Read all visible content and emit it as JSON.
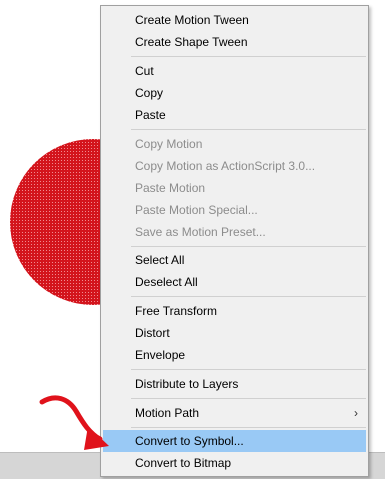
{
  "colors": {
    "circle_fill": "#d3141c",
    "arrow": "#e0121b",
    "menu_bg": "#f0f0f0",
    "highlight": "#99c9f5",
    "disabled_text": "#8c8c8c"
  },
  "menu": {
    "items": [
      {
        "label": "Create Motion Tween"
      },
      {
        "label": "Create Shape Tween"
      },
      {
        "label": "Cut"
      },
      {
        "label": "Copy"
      },
      {
        "label": "Paste"
      },
      {
        "label": "Copy Motion"
      },
      {
        "label": "Copy Motion as ActionScript 3.0..."
      },
      {
        "label": "Paste Motion"
      },
      {
        "label": "Paste Motion Special..."
      },
      {
        "label": "Save as Motion Preset..."
      },
      {
        "label": "Select All"
      },
      {
        "label": "Deselect All"
      },
      {
        "label": "Free Transform"
      },
      {
        "label": "Distort"
      },
      {
        "label": "Envelope"
      },
      {
        "label": "Distribute to Layers"
      },
      {
        "label": "Motion Path",
        "submenu_icon": "chevron-right-icon",
        "arrow": "›"
      },
      {
        "label": "Convert to Symbol..."
      },
      {
        "label": "Convert to Bitmap"
      }
    ]
  }
}
